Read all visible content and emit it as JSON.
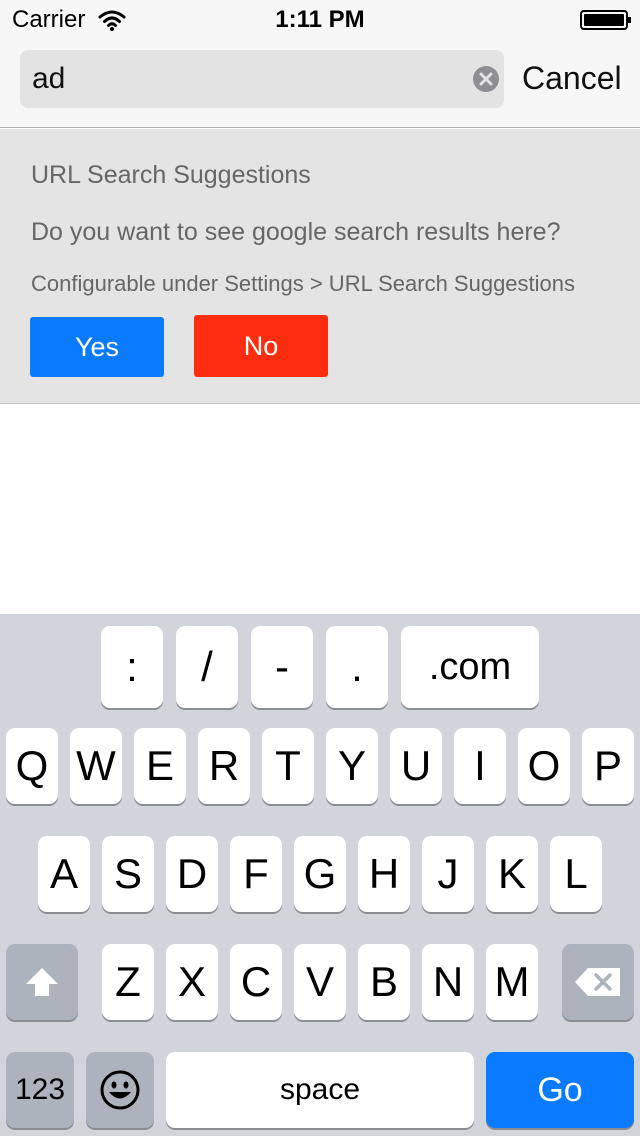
{
  "status_bar": {
    "carrier": "Carrier",
    "time": "1:11 PM"
  },
  "search": {
    "value": "ad",
    "cancel_label": "Cancel"
  },
  "suggestions": {
    "title": "URL Search Suggestions",
    "question": "Do you want to see google search results here?",
    "config_note": "Configurable under Settings > URL Search Suggestions",
    "yes_label": "Yes",
    "no_label": "No",
    "colors": {
      "yes": "#0a7bff",
      "no": "#ff2d0f"
    }
  },
  "keyboard": {
    "url_row": [
      ":",
      "/",
      "-",
      ".",
      ".com"
    ],
    "row1": [
      "Q",
      "W",
      "E",
      "R",
      "T",
      "Y",
      "U",
      "I",
      "O",
      "P"
    ],
    "row2": [
      "A",
      "S",
      "D",
      "F",
      "G",
      "H",
      "J",
      "K",
      "L"
    ],
    "row3": [
      "Z",
      "X",
      "C",
      "V",
      "B",
      "N",
      "M"
    ],
    "numbers_label": "123",
    "space_label": "space",
    "go_label": "Go",
    "icons": {
      "shift": "shift-icon",
      "delete": "backspace-icon",
      "emoji": "emoji-icon"
    }
  }
}
